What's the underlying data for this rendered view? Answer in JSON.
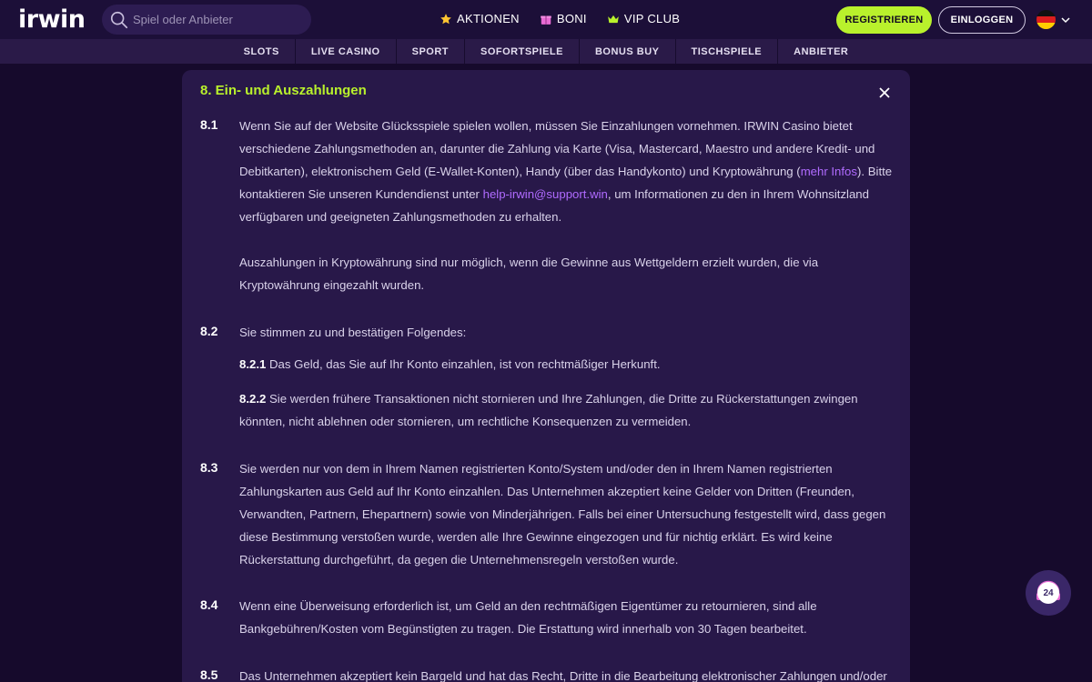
{
  "header": {
    "logo": "irwin",
    "search": {
      "placeholder": "Spiel oder Anbieter"
    },
    "nav": [
      {
        "label": "AKTIONEN",
        "icon": "star-icon"
      },
      {
        "label": "BONI",
        "icon": "gift-icon"
      },
      {
        "label": "VIP CLUB",
        "icon": "crown-icon"
      }
    ],
    "register_label": "REGISTRIEREN",
    "login_label": "EINLOGGEN",
    "language_icon": "germany-flag-icon"
  },
  "subnav": [
    "SLOTS",
    "LIVE CASINO",
    "SPORT",
    "SOFORTSPIELE",
    "BONUS BUY",
    "TISCHSPIELE",
    "ANBIETER"
  ],
  "colors": {
    "accent": "#b9f12c",
    "link": "#b06bff",
    "background": "#160a2c",
    "modal": "#281849"
  },
  "modal": {
    "title": "8. Ein- und Auszahlungen",
    "s81": {
      "num": "8.1",
      "t1": "Wenn Sie auf der Website Glücksspiele spielen wollen, müssen Sie Einzahlungen vornehmen. IRWIN Casino bietet verschiedene Zahlungsmethoden an, darunter die Zahlung via Karte (Visa, Mastercard, Maestro und andere Kredit- und Debitkarten), elektronischem Geld (E-Wallet-Konten), Handy (über das Handykonto) und Kryptowährung (",
      "link1": "mehr Infos",
      "t2": "). Bitte kontaktieren Sie unseren Kundendienst unter ",
      "link2": "help-irwin@support.win",
      "t3": ", um Informationen zu den in Ihrem Wohnsitzland verfügbaren und geeigneten Zahlungsmethoden zu erhalten.",
      "p2": "Auszahlungen in Kryptowährung sind nur möglich, wenn die Gewinne aus Wettgeldern erzielt wurden, die via Kryptowährung eingezahlt wurden."
    },
    "s82": {
      "num": "8.2",
      "intro": "Sie stimmen zu und bestätigen Folgendes:",
      "n1": "8.2.1",
      "t1": " Das Geld, das Sie auf Ihr Konto einzahlen, ist von rechtmäßiger Herkunft.",
      "n2": "8.2.2",
      "t2": " Sie werden frühere Transaktionen nicht stornieren und Ihre Zahlungen, die Dritte zu Rückerstattungen zwingen könnten, nicht ablehnen oder stornieren, um rechtliche Konsequenzen zu vermeiden."
    },
    "s83": {
      "num": "8.3",
      "text": "Sie werden nur von dem in Ihrem Namen registrierten Konto/System und/oder den in Ihrem Namen registrierten Zahlungskarten aus Geld auf Ihr Konto einzahlen. Das Unternehmen akzeptiert keine Gelder von Dritten (Freunden, Verwandten, Partnern, Ehepartnern) sowie von Minderjährigen. Falls bei einer Untersuchung festgestellt wird, dass gegen diese Bestimmung verstoßen wurde, werden alle Ihre Gewinne eingezogen und für nichtig erklärt. Es wird keine Rückerstattung durchgeführt, da gegen die Unternehmensregeln verstoßen wurde."
    },
    "s84": {
      "num": "8.4",
      "text": "Wenn eine Überweisung erforderlich ist, um Geld an den rechtmäßigen Eigentümer zu retournieren, sind alle Bankgebühren/Kosten vom Begünstigten zu tragen. Die Erstattung wird innerhalb von 30 Tagen bearbeitet."
    },
    "s85": {
      "num": "8.5",
      "text": "Das Unternehmen akzeptiert kein Bargeld und hat das Recht, Dritte in die Bearbeitung elektronischer Zahlungen und/oder"
    }
  },
  "chat": {
    "badge": "24",
    "icon": "headset-support-icon"
  }
}
